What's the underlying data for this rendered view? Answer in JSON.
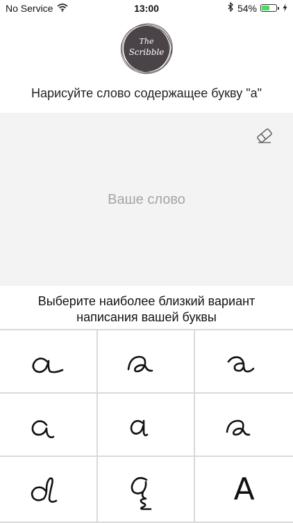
{
  "status_bar": {
    "carrier": "No Service",
    "time": "13:00",
    "battery_percent": "54%",
    "battery_level": 0.54,
    "icons": [
      "wifi-icon",
      "bluetooth-icon",
      "battery-icon",
      "charging-icon"
    ]
  },
  "logo": {
    "line1": "The",
    "line2": "Scribble",
    "color": "#4a4347"
  },
  "prompt": "Нарисуйте слово содержащее букву \"а\"",
  "drawing_area": {
    "placeholder": "Ваше слово",
    "background": "#f3f3f3",
    "icon": "eraser-icon"
  },
  "instruction": {
    "line1": "Выберите наиболее близкий вариант",
    "line2": "написания вашей буквы"
  },
  "options": [
    {
      "id": "variant-1",
      "glyph": "handwritten-a-1"
    },
    {
      "id": "variant-2",
      "glyph": "handwritten-a-2"
    },
    {
      "id": "variant-3",
      "glyph": "handwritten-a-3"
    },
    {
      "id": "variant-4",
      "glyph": "handwritten-a-4"
    },
    {
      "id": "variant-5",
      "glyph": "handwritten-a-5"
    },
    {
      "id": "variant-6",
      "glyph": "handwritten-a-6"
    },
    {
      "id": "variant-7",
      "glyph": "handwritten-a-7"
    },
    {
      "id": "variant-8",
      "glyph": "handwritten-a-8"
    },
    {
      "id": "variant-9",
      "glyph": "printed-A",
      "text": "A"
    }
  ]
}
